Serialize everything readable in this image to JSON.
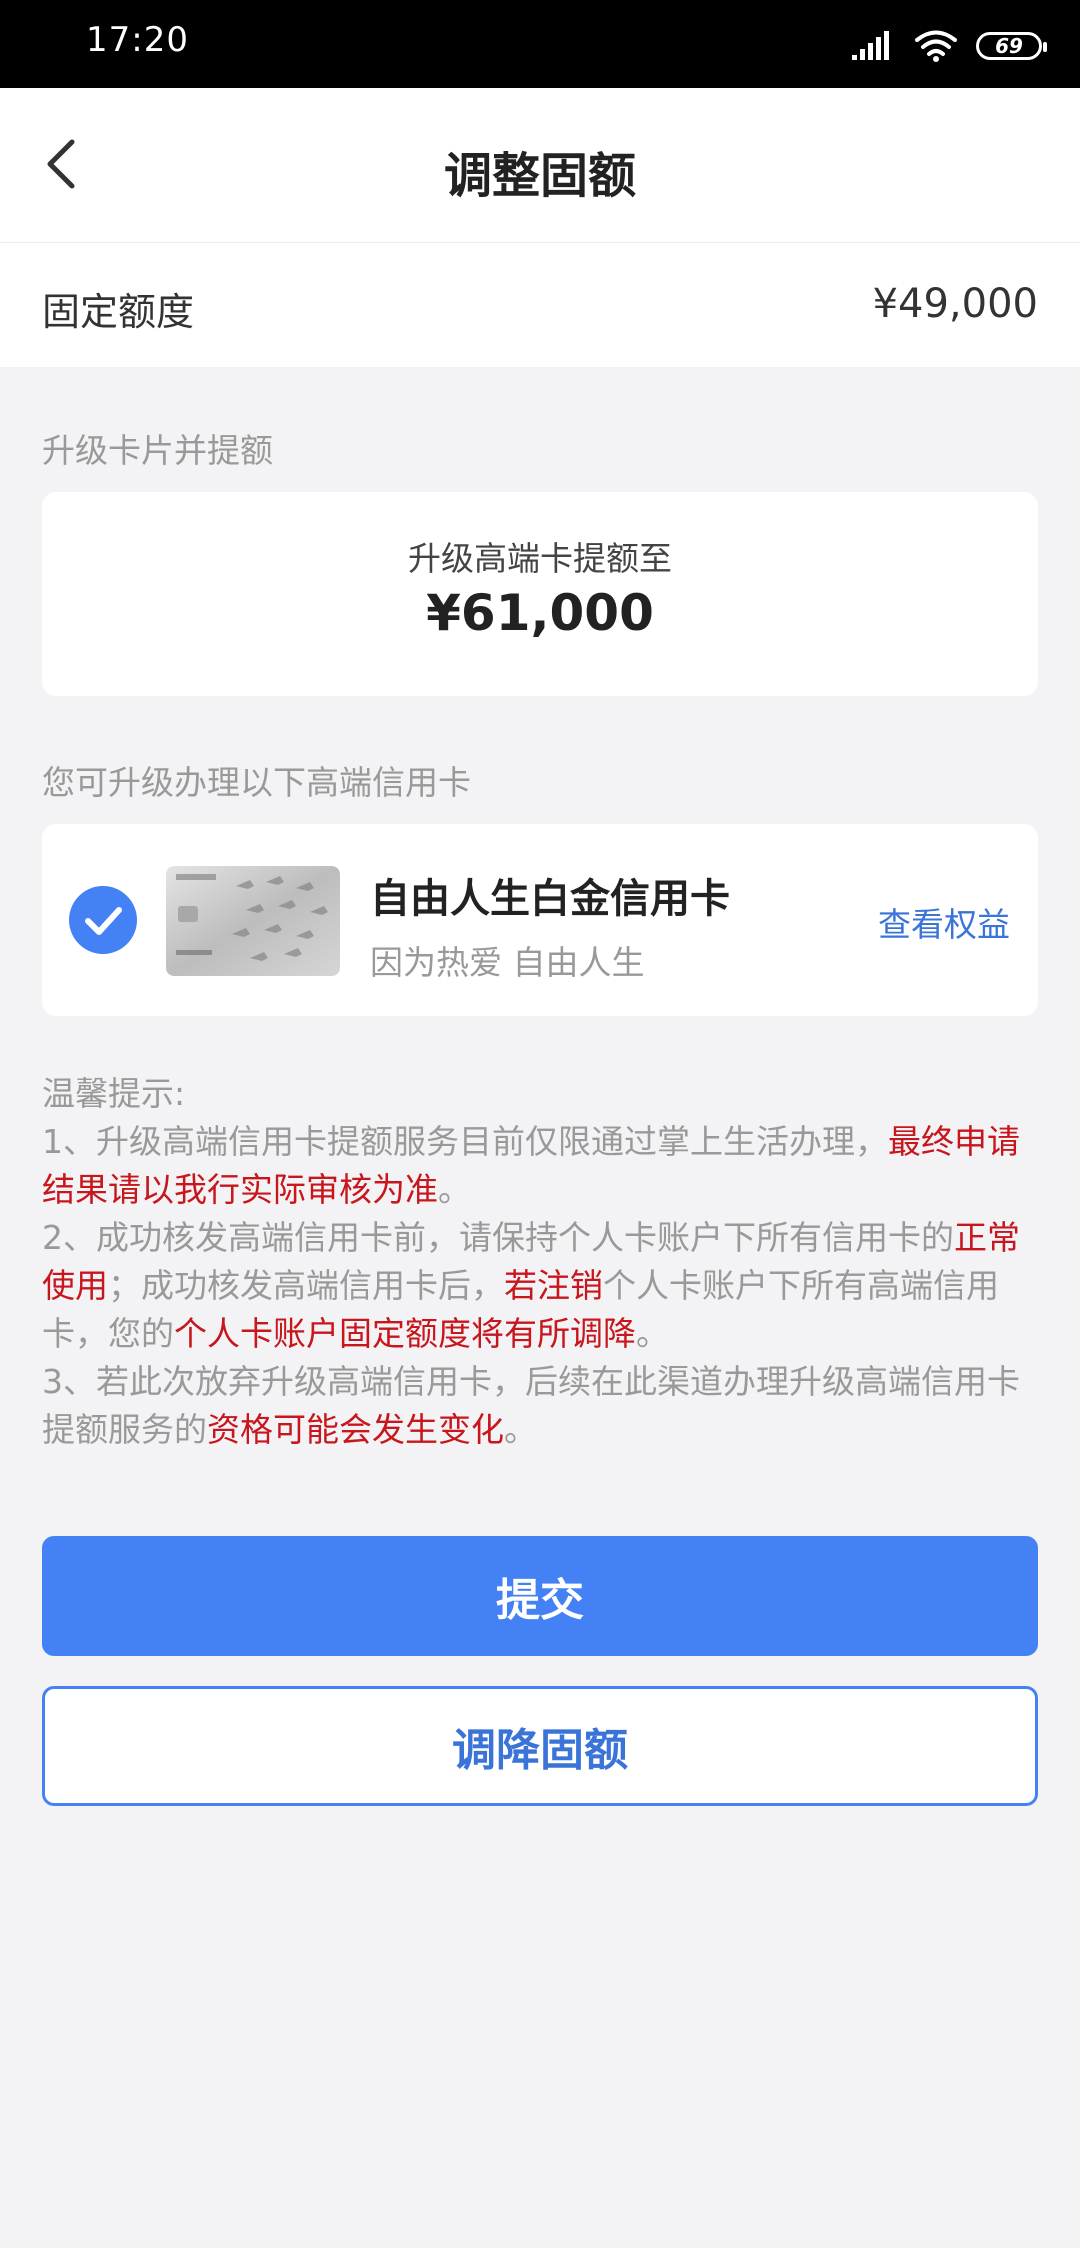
{
  "status": {
    "time": "17:20",
    "battery": "69"
  },
  "header": {
    "title": "调整固额"
  },
  "fixed_limit": {
    "label": "固定额度",
    "value": "¥49,000"
  },
  "upgrade": {
    "section_label": "升级卡片并提额",
    "caption": "升级高端卡提额至",
    "amount": "¥61,000"
  },
  "cards": {
    "section_label": "您可升级办理以下高端信用卡",
    "item": {
      "name": "自由人生白金信用卡",
      "slogan": "因为热爱 自由人生",
      "link": "查看权益",
      "selected": true
    }
  },
  "tips": {
    "title": "温馨提示:",
    "t1a": "1、升级高端信用卡提额服务目前仅限通过掌上生活办理，",
    "t1b": "最终申请结果请以我行实际审核为准",
    "t1c": "。",
    "t2a": "2、成功核发高端信用卡前，请保持个人卡账户下所有信用卡的",
    "t2b": "正常使用",
    "t2c": "；成功核发高端信用卡后，",
    "t2d": "若注销",
    "t2e": "个人卡账户下所有高端信用卡，您的",
    "t2f": "个人卡账户固定额度将有所调降",
    "t2g": "。",
    "t3a": "3、若此次放弃升级高端信用卡，后续在此渠道办理升级高端信用卡提额服务的",
    "t3b": "资格可能会发生变化",
    "t3c": "。"
  },
  "buttons": {
    "submit": "提交",
    "reduce": "调降固额"
  },
  "colors": {
    "accent": "#4381f5",
    "link": "#3a74d9",
    "highlight": "#c8161d"
  }
}
